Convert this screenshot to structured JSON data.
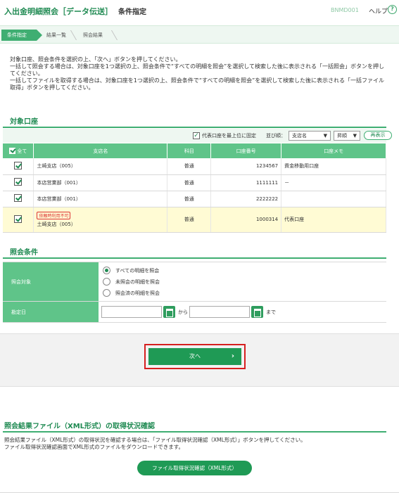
{
  "header": {
    "title": "入出金明細照会［データ伝送］",
    "subtitle": "条件指定",
    "screen_code": "BNMD001",
    "help_label": "ヘルプ",
    "help_icon_glyph": "?"
  },
  "steps": [
    {
      "label": "条件指定",
      "active": true
    },
    {
      "label": "結果一覧",
      "active": false
    },
    {
      "label": "照会結果",
      "active": false
    }
  ],
  "intro": {
    "line1": "対象口座、照会条件を選択の上、「次へ」ボタンを押してください。",
    "line2": "一括して照会する場合は、対象口座を1つ選択の上、照会条件で“すべての明細を照会”を選択して検索した後に表示される「一括照会」ボタンを押し",
    "line3": "てください。",
    "line4": "一括してファイルを取得する場合は、対象口座を1つ選択の上、照会条件で“すべての明細を照会”を選択して検索した後に表示される「一括ファイル",
    "line5": "取得」ボタンを押してください。"
  },
  "accounts": {
    "section_title": "対象口座",
    "toolbar": {
      "pin_label": "代表口座を最上位に固定",
      "sort_label": "並び順：",
      "sort_field": "支店名",
      "sort_order": "昇順",
      "redisplay_label": "再表示"
    },
    "columns": {
      "all": "全て",
      "branch": "支店名",
      "subject": "科目",
      "account_no": "口座番号",
      "memo": "口座メモ"
    },
    "rows": [
      {
        "branch": "土崎支店（005）",
        "subject": "普通",
        "account_no": "1234567",
        "memo": "資金移動用口座",
        "warning": ""
      },
      {
        "branch": "本店営業部（001）",
        "subject": "普通",
        "account_no": "1111111",
        "memo": "－",
        "warning": ""
      },
      {
        "branch": "本店営業部（001）",
        "subject": "普通",
        "account_no": "2222222",
        "memo": "",
        "warning": ""
      },
      {
        "branch": "土崎支店（005）",
        "subject": "普通",
        "account_no": "1000314",
        "memo": "代表口座",
        "warning": "依頼時利用不可"
      }
    ]
  },
  "conditions": {
    "section_title": "照会条件",
    "target_label": "照会対象",
    "options": [
      "すべての明細を照会",
      "未照会の明細を照会",
      "照会済の明細を照会"
    ],
    "selected_index": 0,
    "date_label": "勘定日",
    "from_label": "から",
    "to_label": "まで",
    "from_value": "",
    "to_value": ""
  },
  "actions": {
    "next_label": "次へ",
    "next_arrow": "›"
  },
  "xml_section": {
    "title": "照会結果ファイル（XML形式）の取得状況確認",
    "desc1": "照会結果ファイル（XML形式）の取得状況を確認する場合は、「ファイル取得状況確認（XML形式）」ボタンを押してください。",
    "desc2": "ファイル取得状況確認画面でXML形式のファイルをダウンロードできます。",
    "button_label": "ファイル取得状況確認（XML形式）"
  },
  "colors": {
    "brand_green": "#1f8a52",
    "header_green": "#5fc489",
    "highlight_row": "#fffbd4",
    "focus_red": "#d62020"
  }
}
